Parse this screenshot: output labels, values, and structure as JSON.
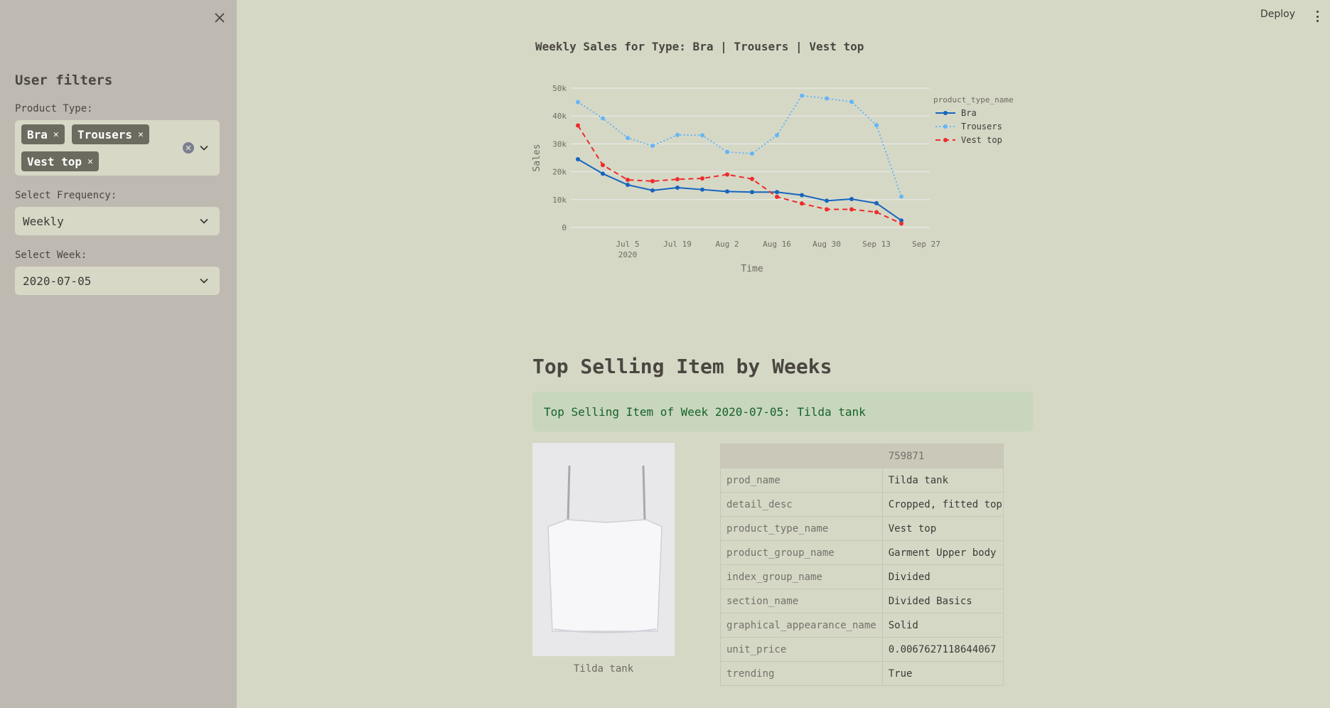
{
  "sidebar": {
    "title": "User filters",
    "product_type_label": "Product Type:",
    "selected_types": [
      "Bra",
      "Trousers",
      "Vest top"
    ],
    "frequency_label": "Select Frequency:",
    "frequency_value": "Weekly",
    "week_label": "Select Week:",
    "week_value": "2020-07-05"
  },
  "header": {
    "deploy_label": "Deploy"
  },
  "chart_data": {
    "type": "line",
    "title": "Weekly Sales for Type: Bra | Trousers | Vest top",
    "xlabel": "Time",
    "ylabel": "Sales",
    "ylim": [
      0,
      50000
    ],
    "y_ticks": [
      0,
      10000,
      20000,
      30000,
      40000,
      50000
    ],
    "y_tick_labels": [
      "0",
      "10k",
      "20k",
      "30k",
      "40k",
      "50k"
    ],
    "x_tick_labels": [
      "Jul 5\n2020",
      "Jul 19",
      "Aug 2",
      "Aug 16",
      "Aug 30",
      "Sep 13",
      "Sep 27"
    ],
    "x": [
      "2020-06-21",
      "2020-06-28",
      "2020-07-05",
      "2020-07-12",
      "2020-07-19",
      "2020-07-26",
      "2020-08-02",
      "2020-08-09",
      "2020-08-16",
      "2020-08-23",
      "2020-08-30",
      "2020-09-06",
      "2020-09-13",
      "2020-09-20",
      "2020-09-27"
    ],
    "legend_title": "product_type_name",
    "legend_position": "top-right",
    "grid": true,
    "series": [
      {
        "name": "Bra",
        "color": "#1565c0",
        "dash": "solid",
        "values": [
          24500,
          19300,
          15300,
          13300,
          14300,
          13600,
          12900,
          12700,
          12700,
          11600,
          9600,
          10200,
          8700,
          2500
        ]
      },
      {
        "name": "Trousers",
        "color": "#64b5f6",
        "dash": "dot",
        "values": [
          45000,
          39200,
          32100,
          29300,
          33200,
          33100,
          27100,
          26500,
          33100,
          47300,
          46300,
          45100,
          36700,
          11100
        ]
      },
      {
        "name": "Vest top",
        "color": "#ef2b2b",
        "dash": "dash",
        "values": [
          36600,
          22400,
          17100,
          16600,
          17300,
          17600,
          19000,
          17400,
          11000,
          8600,
          6500,
          6500,
          5500,
          1400
        ]
      }
    ]
  },
  "top_selling": {
    "heading": "Top Selling Item by Weeks",
    "message": "Top Selling Item of Week 2020-07-05: Tilda tank",
    "image_caption": "Tilda tank",
    "column_header": "759871",
    "rows": [
      {
        "key": "prod_name",
        "value": "Tilda tank"
      },
      {
        "key": "detail_desc",
        "value": "Cropped, fitted top"
      },
      {
        "key": "product_type_name",
        "value": "Vest top"
      },
      {
        "key": "product_group_name",
        "value": "Garment Upper body"
      },
      {
        "key": "index_group_name",
        "value": "Divided"
      },
      {
        "key": "section_name",
        "value": "Divided Basics"
      },
      {
        "key": "graphical_appearance_name",
        "value": "Solid"
      },
      {
        "key": "unit_price",
        "value": "0.0067627118644067"
      },
      {
        "key": "trending",
        "value": "True"
      }
    ]
  }
}
